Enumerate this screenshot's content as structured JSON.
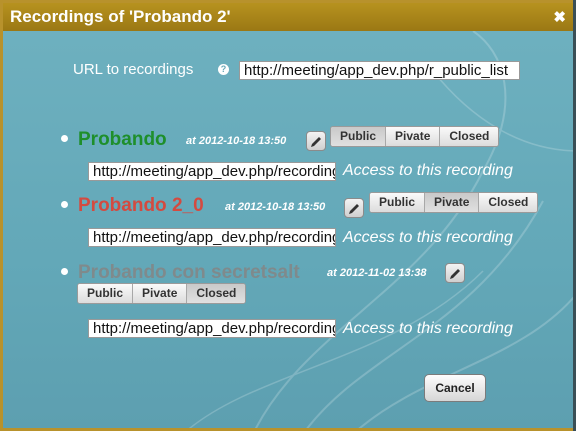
{
  "dialog": {
    "title": "Recordings of 'Probando 2'",
    "close_glyph": "✖"
  },
  "url_section": {
    "label": "URL to recordings",
    "help_glyph": "?",
    "value": "http://meeting/app_dev.php/r_public_list"
  },
  "recordings": [
    {
      "name": "Probando",
      "name_color": "#1e8f2b",
      "date": "at 2012-10-18 13:50",
      "visibility_options": [
        "Public",
        "Pivate",
        "Closed"
      ],
      "selected": "Public",
      "link": "http://meeting/app_dev.php/recording",
      "access_label": "Access to this recording"
    },
    {
      "name": "Probando 2_0",
      "name_color": "#d44a40",
      "date": "at 2012-10-18 13:50",
      "visibility_options": [
        "Public",
        "Pivate",
        "Closed"
      ],
      "selected": "Pivate",
      "link": "http://meeting/app_dev.php/recording",
      "access_label": "Access to this recording"
    },
    {
      "name": "Probando con secretsalt",
      "name_color": "#7f8a8c",
      "date": "at 2012-11-02 13:38",
      "visibility_options": [
        "Public",
        "Pivate",
        "Closed"
      ],
      "selected": "Closed",
      "link": "http://meeting/app_dev.php/recording",
      "access_label": "Access to this recording"
    }
  ],
  "icons": {
    "edit": "pencil-icon",
    "help": "question-icon",
    "close": "close-icon"
  },
  "footer": {
    "cancel_label": "Cancel"
  }
}
